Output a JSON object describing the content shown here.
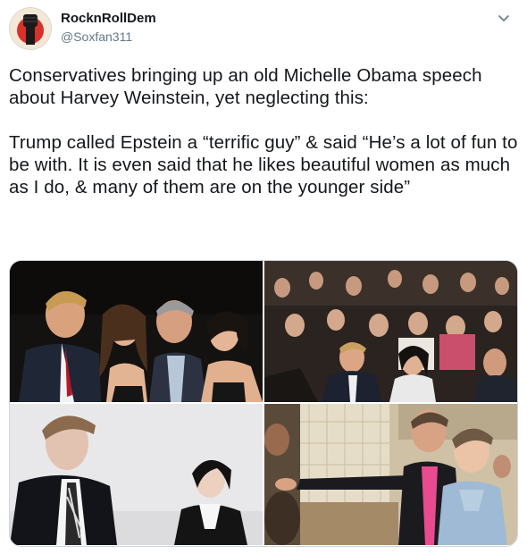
{
  "user": {
    "display_name": "RocknRollDem",
    "handle": "@Soxfan311",
    "avatar_icon": "raised-fist-avatar"
  },
  "menu_icon": "chevron-down-icon",
  "tweet": {
    "paragraph_1": "Conservatives bringing up an old Michelle Obama speech about Harvey Weinstein, yet neglecting this:",
    "paragraph_2": "Trump called Epstein a “terrific guy” & said “He’s a lot of fun to be with. It is even said that he likes beautiful women as much as I do, & many of them are on the younger side”"
  },
  "media": {
    "photo_count": 4
  },
  "colors": {
    "text": "#14171a",
    "secondary": "#657786",
    "border": "#ccd6dd"
  }
}
